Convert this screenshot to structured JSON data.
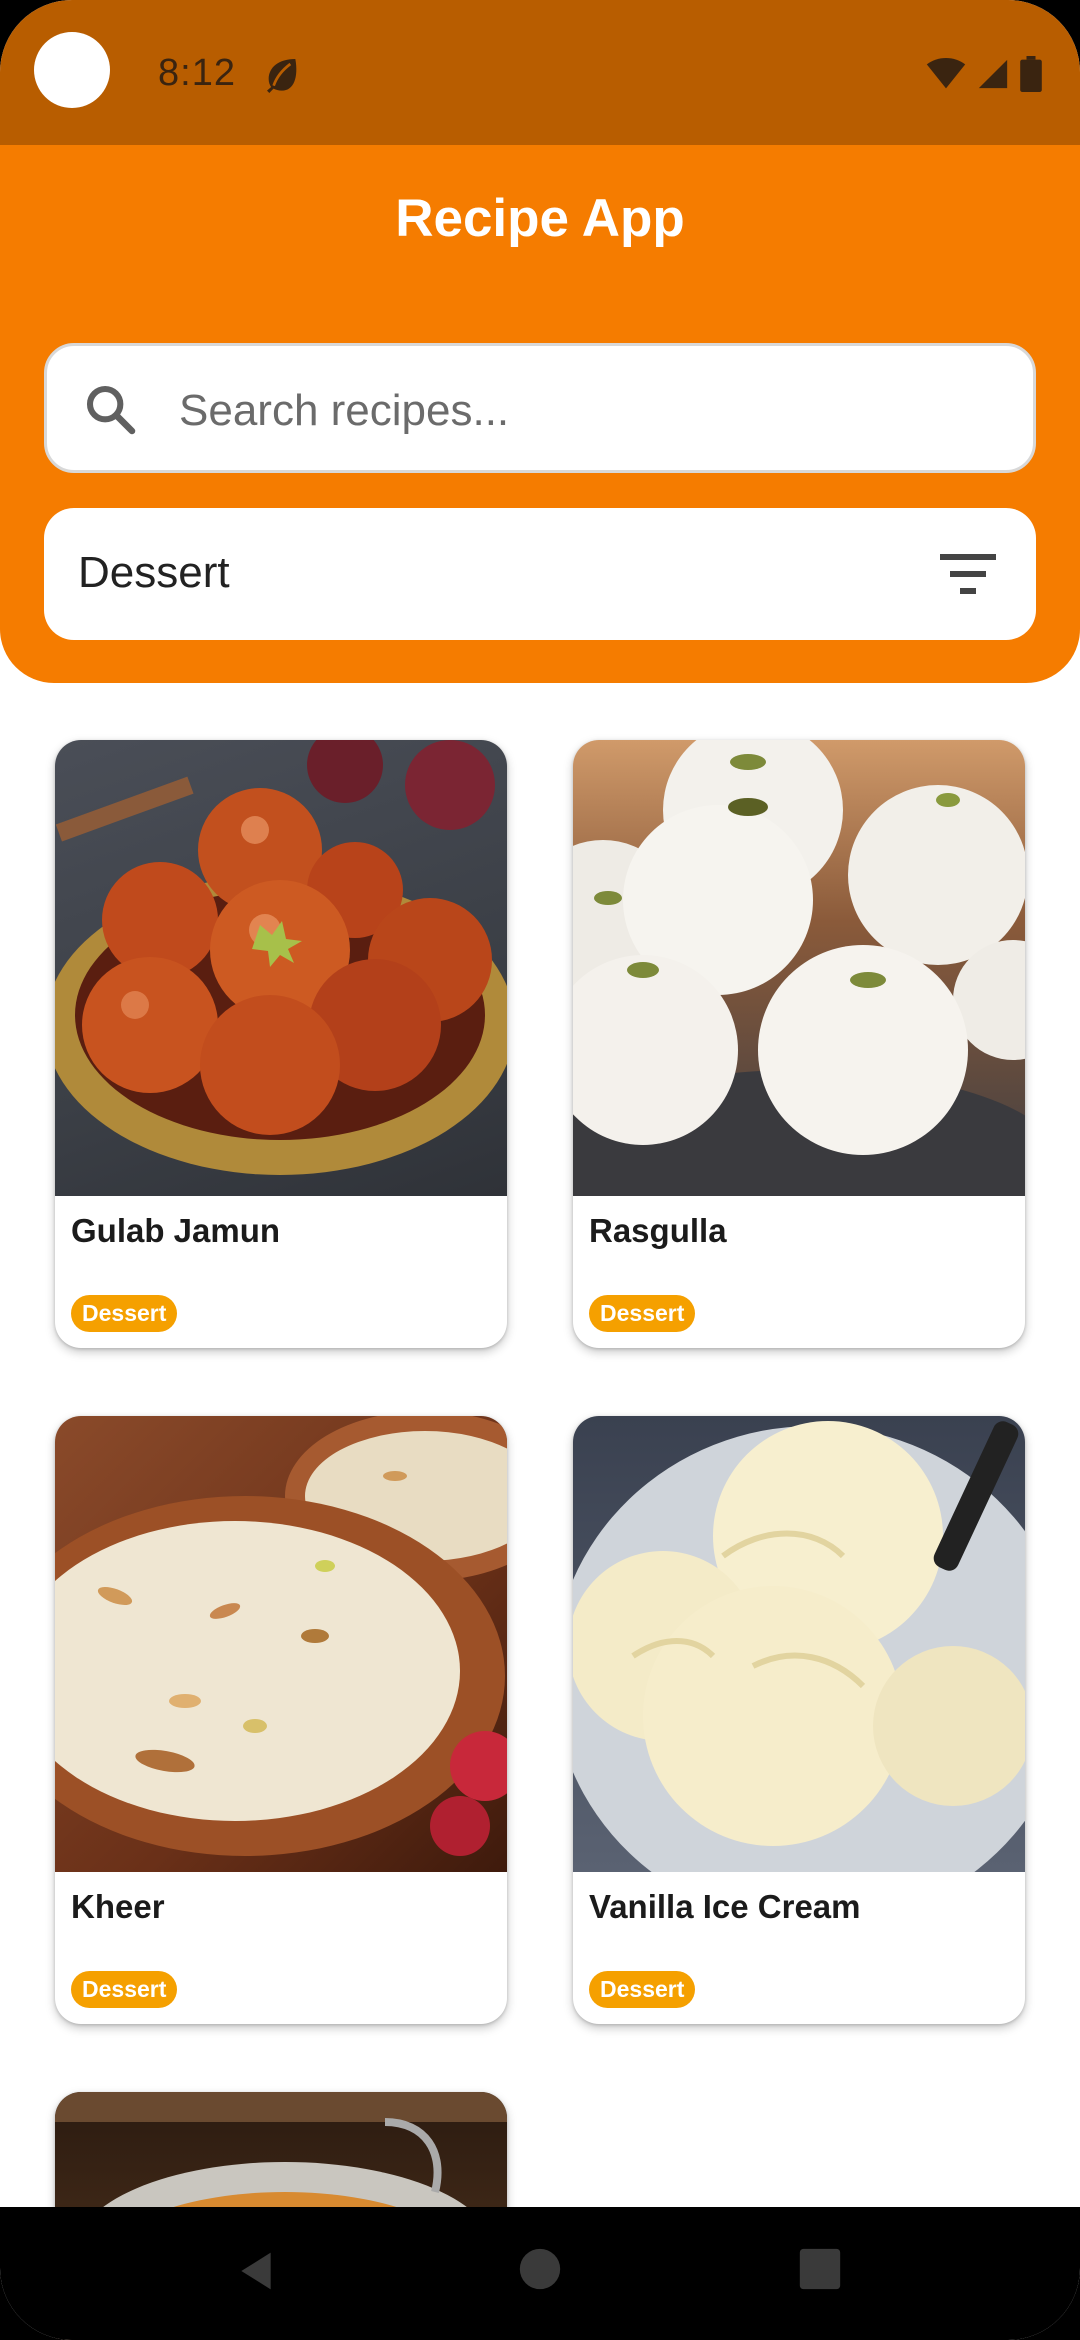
{
  "status_bar": {
    "time": "8:12",
    "icons": [
      "leaf-icon",
      "wifi-icon",
      "signal-icon",
      "battery-icon"
    ]
  },
  "app": {
    "title": "Recipe App"
  },
  "search": {
    "placeholder": "Search recipes...",
    "value": ""
  },
  "filter": {
    "selected": "Dessert",
    "icon": "filter-icon"
  },
  "recipes": [
    {
      "name": "Gulab Jamun",
      "category": "Dessert"
    },
    {
      "name": "Rasgulla",
      "category": "Dessert"
    },
    {
      "name": "Kheer",
      "category": "Dessert"
    },
    {
      "name": "Vanilla Ice Cream",
      "category": "Dessert"
    }
  ],
  "colors": {
    "primary": "#F57C00",
    "status_bar": "#B85D00",
    "badge": "#F5A000"
  },
  "nav": {
    "icons": [
      "back-icon",
      "home-icon",
      "recents-icon"
    ]
  }
}
